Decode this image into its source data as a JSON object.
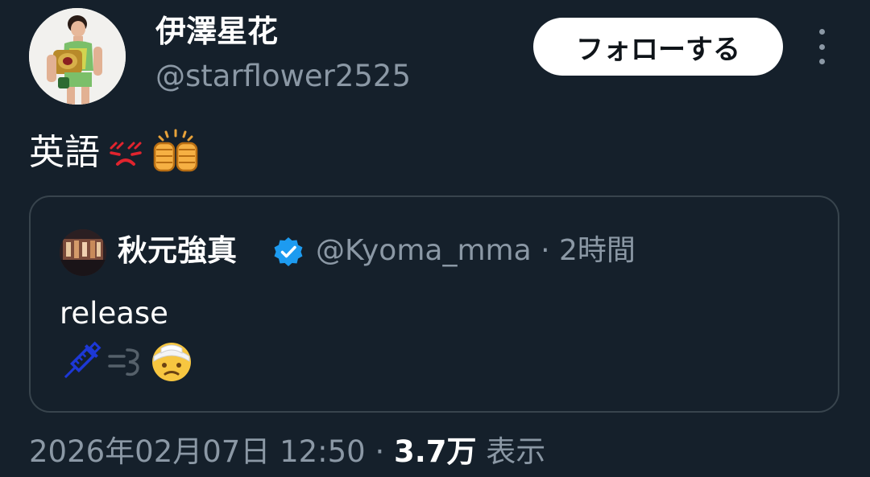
{
  "author": {
    "display_name": "伊澤星花",
    "handle": "@starflower2525",
    "avatar_icon": "profile-photo-champion-belt"
  },
  "follow_label": "フォローする",
  "more_icon": "more-vertical-icon",
  "tweet": {
    "text": "英語",
    "emojis": [
      "angry-face-emoji",
      "fist-bump-emoji"
    ]
  },
  "quote": {
    "display_name": "秋元強真",
    "verified": true,
    "handle_time": "@Kyoma_mma · 2時間",
    "text": "release",
    "emojis": [
      "syringe-emoji",
      "dash-emoji",
      "bandaged-face-emoji"
    ]
  },
  "meta": {
    "timestamp": "2026年02月07日 12:50 · ",
    "views_count": "3.7万",
    "views_label": " 表示"
  },
  "colors": {
    "background": "#15202b",
    "text_primary": "#ffffff",
    "text_secondary": "#8b98a5",
    "border": "#38444d",
    "verified": "#1d9bf0",
    "follow_bg": "#ffffff"
  }
}
